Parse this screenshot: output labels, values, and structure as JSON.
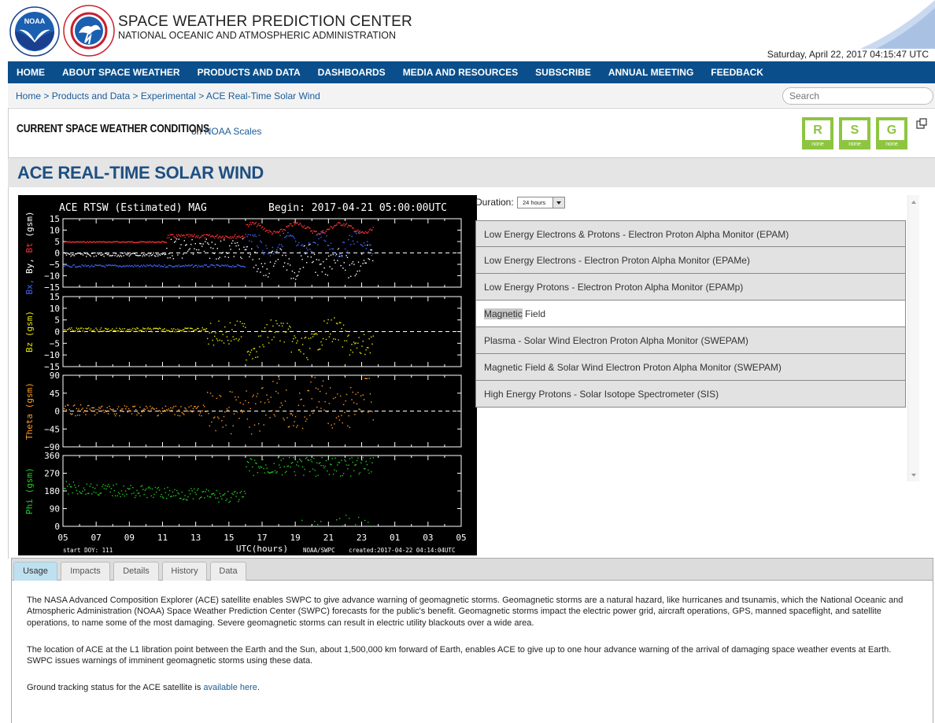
{
  "header": {
    "title": "SPACE WEATHER PREDICTION CENTER",
    "subtitle": "NATIONAL OCEANIC AND ATMOSPHERIC ADMINISTRATION",
    "datetime": "Saturday, April 22, 2017 04:15:47 UTC",
    "noaa_logo_text": "NOAA",
    "nws_logo_text": "NATIONAL WEATHER SERVICE"
  },
  "nav": {
    "items": [
      "HOME",
      "ABOUT SPACE WEATHER",
      "PRODUCTS AND DATA",
      "DASHBOARDS",
      "MEDIA AND RESOURCES",
      "SUBSCRIBE",
      "ANNUAL MEETING",
      "FEEDBACK"
    ]
  },
  "breadcrumb": {
    "items": [
      "Home",
      "Products and Data",
      "Experimental",
      "ACE Real-Time Solar Wind"
    ],
    "separator": ">"
  },
  "search": {
    "placeholder": "Search"
  },
  "conditions": {
    "title": "CURRENT SPACE WEATHER CONDITIONS",
    "on_text": "on",
    "link": "NOAA Scales",
    "scales": [
      {
        "letter": "R",
        "status": "none"
      },
      {
        "letter": "S",
        "status": "none"
      },
      {
        "letter": "G",
        "status": "none"
      }
    ],
    "scale_color": "#8dc540"
  },
  "page_title": "ACE REAL-TIME SOLAR WIND",
  "plot": {
    "title": "ACE RTSW (Estimated) MAG",
    "begin": "Begin: 2017-04-21 05:00:00UTC",
    "panels": [
      {
        "ylabel": [
          "Bx,",
          "By,",
          "Bt",
          "(gsm)"
        ],
        "ylabel_colors": [
          "#4169ff",
          "#ffffff",
          "#ff3030",
          "#ffffff"
        ],
        "ticks": [
          "15",
          "10",
          "5",
          "0",
          "−5",
          "−10",
          "−15"
        ]
      },
      {
        "ylabel": [
          "Bz",
          "(gsm)"
        ],
        "ylabel_colors": [
          "#e8e800",
          "#e8e800"
        ],
        "ticks": [
          "15",
          "10",
          "5",
          "0",
          "−5",
          "−10",
          "−15"
        ]
      },
      {
        "ylabel": [
          "Theta",
          "(gsm)"
        ],
        "ylabel_colors": [
          "#ff9a20",
          "#ff9a20"
        ],
        "ticks": [
          "90",
          "45",
          "0",
          "−45",
          "−90"
        ]
      },
      {
        "ylabel": [
          "Phi",
          "(gsm)"
        ],
        "ylabel_colors": [
          "#22cc22",
          "#22cc22"
        ],
        "ticks": [
          "360",
          "270",
          "180",
          "90",
          "0"
        ]
      }
    ],
    "xticks": [
      "05",
      "07",
      "09",
      "11",
      "13",
      "15",
      "17",
      "19",
      "21",
      "23",
      "01",
      "03",
      "05"
    ],
    "xlabel": "UTC(hours)",
    "start_doy": "start DOY:  111",
    "source": "NOAA/SWPC",
    "created": "created:2017-04-22 04:14:04UTC"
  },
  "duration": {
    "label": "Duration:",
    "value": "24 hours"
  },
  "products": [
    {
      "label": "Low Energy Electrons & Protons - Electron Proton Alpha Monitor (EPAM)",
      "active": false
    },
    {
      "label": "Low Energy Electrons - Electron Proton Alpha Monitor (EPAMe)",
      "active": false
    },
    {
      "label": "Low Energy Protons - Electron Proton Alpha Monitor (EPAMp)",
      "active": false
    },
    {
      "label_highlight": "Magnetic",
      "label_rest": " Field",
      "active": true
    },
    {
      "label": "Plasma - Solar Wind Electron Proton Alpha Monitor (SWEPAM)",
      "active": false
    },
    {
      "label": "Magnetic Field & Solar Wind Electron Proton Alpha Monitor (SWEPAM)",
      "active": false
    },
    {
      "label": "High Energy Protons - Solar Isotope Spectrometer (SIS)",
      "active": false
    }
  ],
  "tabs": [
    "Usage",
    "Impacts",
    "Details",
    "History",
    "Data"
  ],
  "usage": {
    "p1": "The NASA Advanced Composition Explorer (ACE) satellite enables SWPC to give advance warning of geomagnetic storms. Geomagnetic storms are a natural hazard, like hurricanes and tsunamis, which the National Oceanic and Atmospheric Administration (NOAA) Space Weather Prediction Center (SWPC) forecasts for the public's benefit. Geomagnetic storms impact the electric power grid, aircraft operations, GPS, manned spaceflight, and satellite operations, to name some of the most damaging. Severe geomagnetic storms can result in electric utility blackouts over a wide area.",
    "p2": "The location of ACE at the L1 libration point between the Earth and the Sun, about 1,500,000 km forward of Earth, enables ACE to give up to one hour advance warning of the arrival of damaging space weather events at Earth. SWPC issues warnings of imminent geomagnetic storms using these data.",
    "p3_prefix": "Ground tracking status for the ACE satellite is",
    "p3_link": "available here",
    "p3_suffix": "."
  },
  "colors": {
    "nav_bg": "#0a4f8c",
    "title": "#1f4f82",
    "link": "#1a5c99",
    "bx": "#4169ff",
    "by": "#ffffff",
    "bt": "#ff3030",
    "bz": "#e8e800",
    "theta": "#ff9a20",
    "phi": "#22cc22"
  }
}
